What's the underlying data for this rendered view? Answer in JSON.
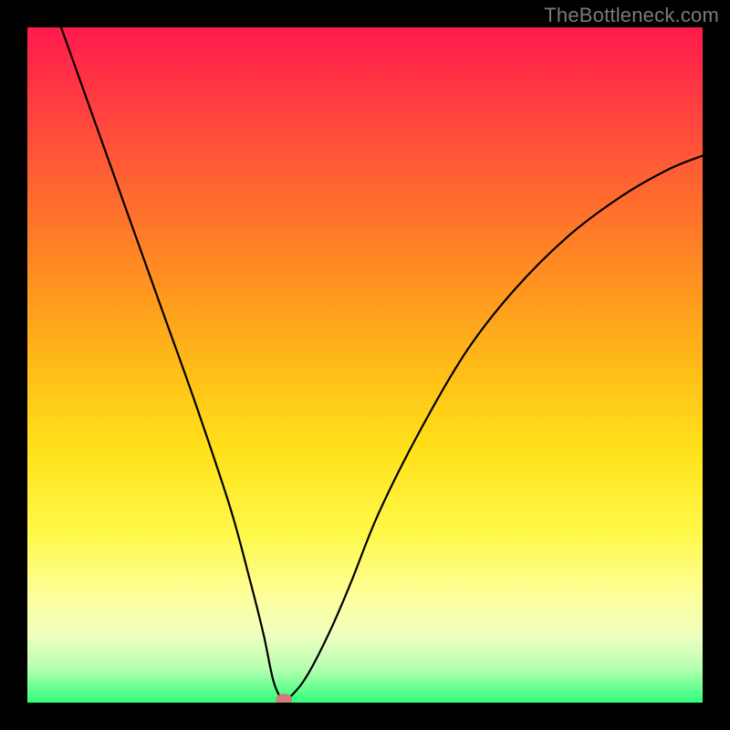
{
  "watermark": {
    "text": "TheBottleneck.com"
  },
  "chart_data": {
    "type": "line",
    "title": "",
    "xlabel": "",
    "ylabel": "",
    "xlim": [
      0,
      100
    ],
    "ylim": [
      0,
      100
    ],
    "grid": false,
    "legend": false,
    "series": [
      {
        "name": "bottleneck-curve",
        "x": [
          5,
          10,
          15,
          20,
          25,
          30,
          33,
          35,
          36.5,
          38,
          40,
          42,
          45,
          48,
          52,
          58,
          65,
          72,
          80,
          88,
          95,
          100
        ],
        "y": [
          100,
          86,
          72,
          58,
          44,
          29,
          18,
          10,
          3,
          0.5,
          2,
          5,
          11,
          18,
          28,
          40,
          52,
          61,
          69,
          75,
          79,
          81
        ]
      }
    ],
    "marker": {
      "x": 38,
      "y": 0.5,
      "shape": "pill",
      "color": "#d37b79"
    },
    "colors": {
      "curve": "#000000",
      "background_top": "#ff1a4d",
      "background_bottom": "#2fff7a",
      "marker": "#d37b79"
    }
  }
}
